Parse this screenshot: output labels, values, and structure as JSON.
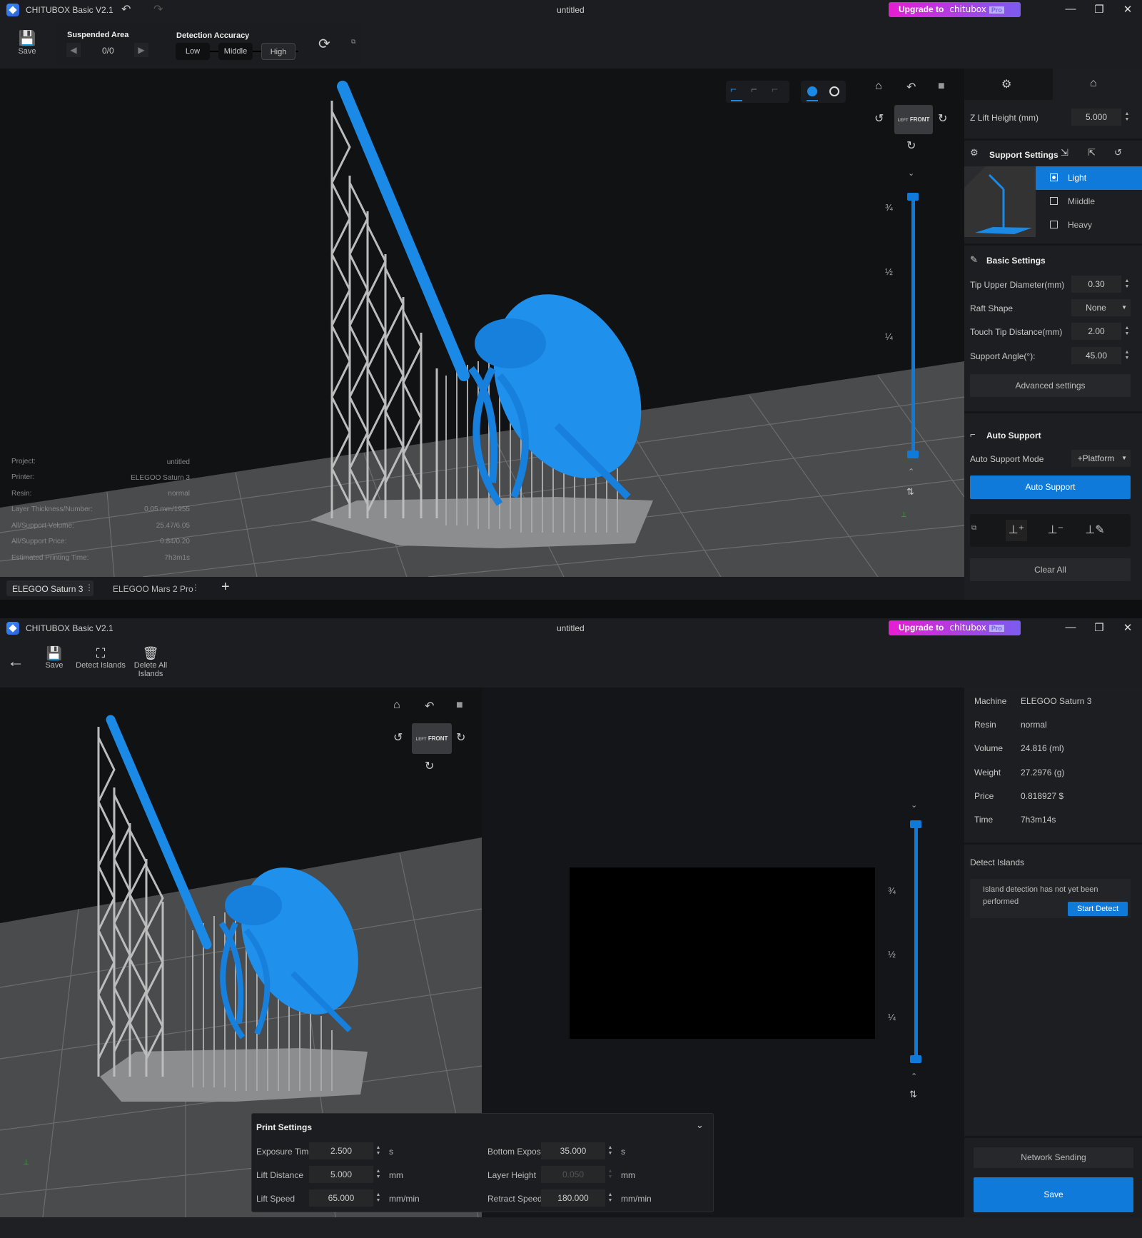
{
  "top_window": {
    "app_title": "CHITUBOX Basic V2.1",
    "doc_title": "untitled",
    "upgrade": {
      "prefix": "Upgrade to",
      "brand": "chitubox",
      "badge": "Pro"
    },
    "toolbar": {
      "save_label": "Save",
      "suspended_area": {
        "title": "Suspended Area",
        "value": "0/0"
      },
      "detection_accuracy": {
        "title": "Detection Accuracy",
        "options": [
          "Low",
          "Middle",
          "High"
        ],
        "selected": "High"
      }
    },
    "cube": {
      "left": "LEFT",
      "front": "FRONT"
    },
    "slider": {
      "labels": [
        "¾",
        "½",
        "¼"
      ],
      "upper": 1.0,
      "lower": 0.0
    },
    "info": [
      {
        "label": "Project:",
        "value": "untitled"
      },
      {
        "label": "Printer:",
        "value": "ELEGOO Saturn 3"
      },
      {
        "label": "Resin:",
        "value": "normal"
      },
      {
        "label": "Layer Thickness/Number:",
        "value": "0.05 mm/1955"
      },
      {
        "label": "All/Support Volume:",
        "value": "25.47/6.05"
      },
      {
        "label": "All/Support Price:",
        "value": "0.84/0.20"
      },
      {
        "label": "Estimated Printing Time:",
        "value": "7h3m1s"
      }
    ],
    "printer_tabs": [
      {
        "label": "ELEGOO Saturn 3",
        "active": true
      },
      {
        "label": "ELEGOO Mars 2 Pro",
        "active": false
      }
    ],
    "right_panel": {
      "z_lift": {
        "label": "Z Lift Height (mm)",
        "value": "5.000"
      },
      "support_settings": {
        "title": "Support Settings",
        "options": [
          "Light",
          "Miiddle",
          "Heavy"
        ],
        "selected": "Light"
      },
      "basic_settings": {
        "title": "Basic Settings",
        "rows": [
          {
            "label": "Tip Upper Diameter(mm)",
            "value": "0.30",
            "type": "spin"
          },
          {
            "label": "Raft Shape",
            "value": "None",
            "type": "select"
          },
          {
            "label": "Touch Tip Distance(mm)",
            "value": "2.00",
            "type": "spin"
          },
          {
            "label": "Support Angle(°):",
            "value": "45.00",
            "type": "spin"
          }
        ]
      },
      "advanced_label": "Advanced settings",
      "auto_support": {
        "title": "Auto Support",
        "mode_label": "Auto Support Mode",
        "mode_value": "+Platform",
        "button": "Auto Support"
      },
      "clear_all": "Clear All"
    }
  },
  "bottom_window": {
    "app_title": "CHITUBOX Basic V2.1",
    "doc_title": "untitled",
    "upgrade": {
      "prefix": "Upgrade to",
      "brand": "chitubox",
      "badge": "Pro"
    },
    "toolbar": {
      "save": "Save",
      "detect": "Detect Islands",
      "delete": "Delete All Islands"
    },
    "cube": {
      "left": "LEFT",
      "front": "FRONT"
    },
    "slider": {
      "labels": [
        "¾",
        "½",
        "¼"
      ],
      "upper": 1.0,
      "lower": 0.0
    },
    "machine_info": [
      {
        "label": "Machine",
        "value": "ELEGOO Saturn 3"
      },
      {
        "label": "Resin",
        "value": "normal"
      },
      {
        "label": "Volume",
        "value": "24.816 (ml)"
      },
      {
        "label": "Weight",
        "value": "27.2976 (g)"
      },
      {
        "label": "Price",
        "value": "0.818927 $"
      },
      {
        "label": "Time",
        "value": "7h3m14s"
      }
    ],
    "detect_islands": {
      "title": "Detect Islands",
      "message": "Island detection has not yet been performed",
      "button": "Start Detect"
    },
    "network_sending": "Network Sending",
    "save": "Save",
    "print_settings": {
      "title": "Print Settings",
      "rows": [
        {
          "label": "Exposure Time",
          "value": "2.500",
          "unit": "s"
        },
        {
          "label": "Bottom Expos...",
          "value": "35.000",
          "unit": "s"
        },
        {
          "label": "Lift Distance",
          "value": "5.000",
          "unit": "mm"
        },
        {
          "label": "Layer Height",
          "value": "0.050",
          "unit": "mm",
          "disabled": true
        },
        {
          "label": "Lift Speed",
          "value": "65.000",
          "unit": "mm/min"
        },
        {
          "label": "Retract Speed",
          "value": "180.000",
          "unit": "mm/min"
        }
      ]
    }
  },
  "colors": {
    "accent": "#0f7ad9",
    "model": "#1a8ae6",
    "support": "#b8b8b8",
    "upgrade_start": "#e61ed2",
    "upgrade_end": "#7b5cf0"
  }
}
